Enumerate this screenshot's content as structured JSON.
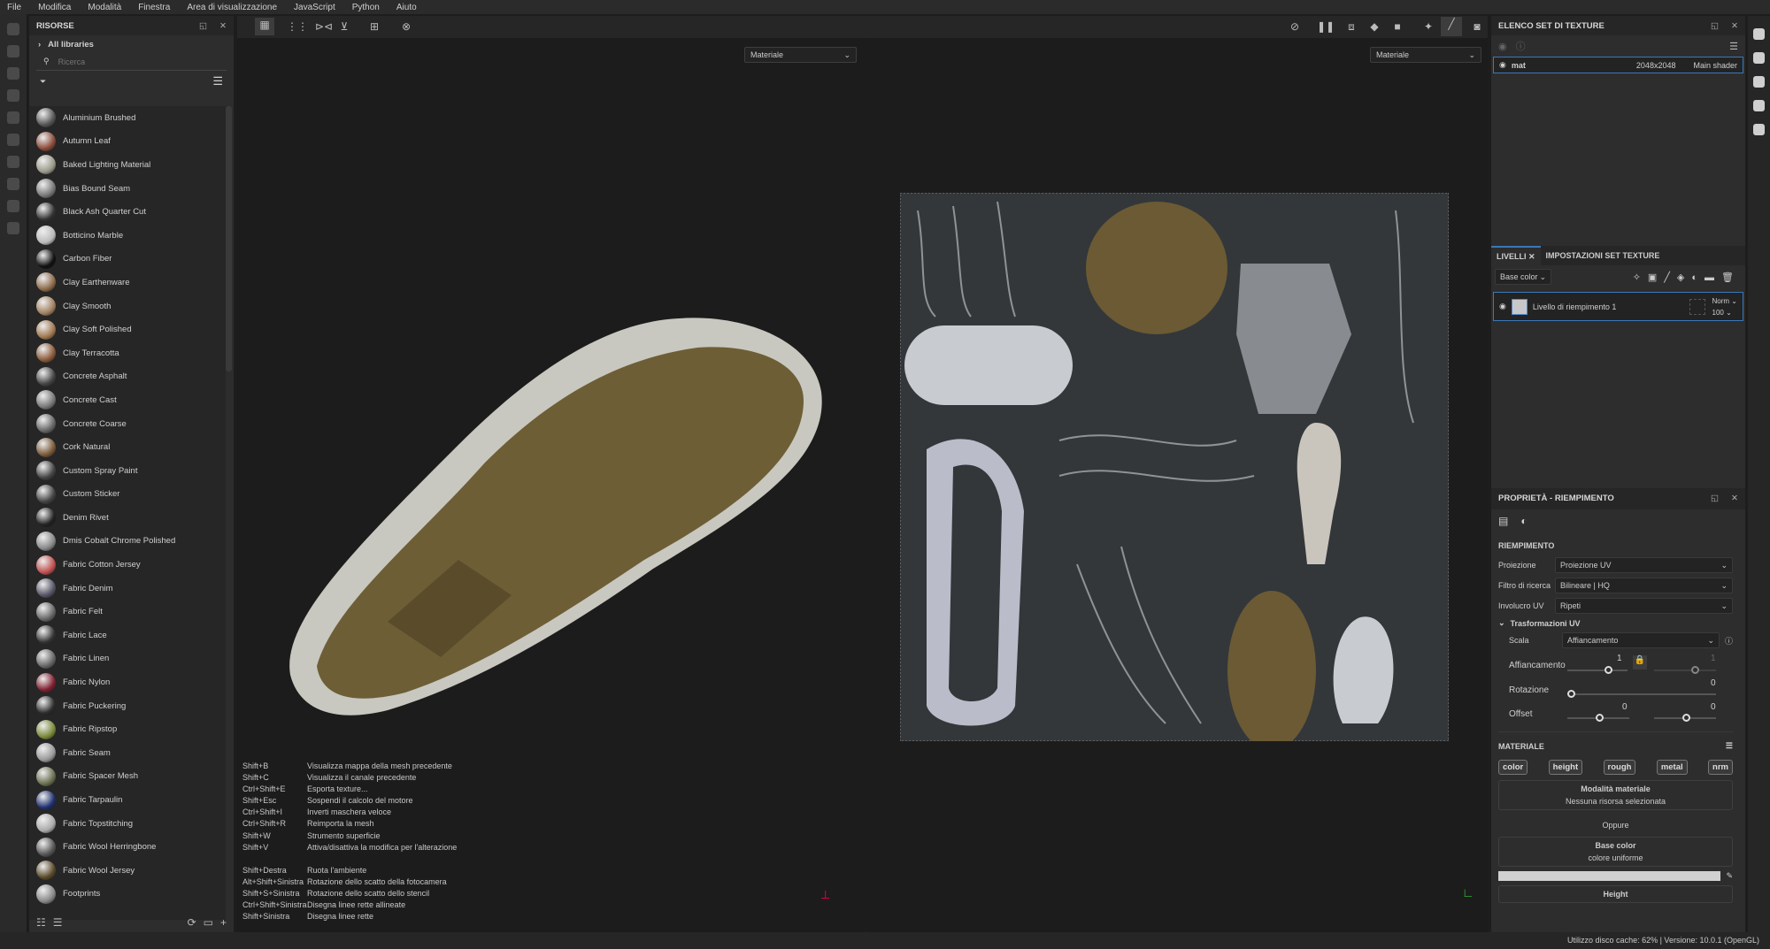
{
  "menu": [
    "File",
    "Modifica",
    "Modalità",
    "Finestra",
    "Area di visualizzazione",
    "JavaScript",
    "Python",
    "Aiuto"
  ],
  "assets": {
    "title": "RISORSE",
    "library": "All libraries",
    "search_placeholder": "Ricerca",
    "items": [
      {
        "label": "Aluminium Brushed",
        "color": "#555"
      },
      {
        "label": "Autumn Leaf",
        "color": "#8a4a3a"
      },
      {
        "label": "Baked Lighting Material",
        "color": "#9a9a8a"
      },
      {
        "label": "Bias Bound Seam",
        "color": "#777"
      },
      {
        "label": "Black Ash Quarter Cut",
        "color": "#333"
      },
      {
        "label": "Botticino Marble",
        "color": "#bbb"
      },
      {
        "label": "Carbon Fiber",
        "color": "#111"
      },
      {
        "label": "Clay Earthenware",
        "color": "#8c6a4a"
      },
      {
        "label": "Clay Smooth",
        "color": "#a08060"
      },
      {
        "label": "Clay Soft Polished",
        "color": "#a07850"
      },
      {
        "label": "Clay Terracotta",
        "color": "#8a5a3a"
      },
      {
        "label": "Concrete Asphalt",
        "color": "#444"
      },
      {
        "label": "Concrete Cast",
        "color": "#777"
      },
      {
        "label": "Concrete Coarse",
        "color": "#666"
      },
      {
        "label": "Cork Natural",
        "color": "#7a5a3a"
      },
      {
        "label": "Custom Spray Paint",
        "color": "#444"
      },
      {
        "label": "Custom Sticker",
        "color": "#444"
      },
      {
        "label": "Denim Rivet",
        "color": "#222"
      },
      {
        "label": "Dmis Cobalt Chrome Polished",
        "color": "#888"
      },
      {
        "label": "Fabric Cotton Jersey",
        "color": "#c05050"
      },
      {
        "label": "Fabric Denim",
        "color": "#556"
      },
      {
        "label": "Fabric Felt",
        "color": "#666"
      },
      {
        "label": "Fabric Lace",
        "color": "#333"
      },
      {
        "label": "Fabric Linen",
        "color": "#666"
      },
      {
        "label": "Fabric Nylon",
        "color": "#802030"
      },
      {
        "label": "Fabric Puckering",
        "color": "#2d2d2d"
      },
      {
        "label": "Fabric Ripstop",
        "color": "#7a8a3a"
      },
      {
        "label": "Fabric Seam",
        "color": "#999"
      },
      {
        "label": "Fabric Spacer Mesh",
        "color": "#6a7050"
      },
      {
        "label": "Fabric Tarpaulin",
        "color": "#203070"
      },
      {
        "label": "Fabric Topstitching",
        "color": "#aaa"
      },
      {
        "label": "Fabric Wool Herringbone",
        "color": "#555"
      },
      {
        "label": "Fabric Wool Jersey",
        "color": "#5a4a2a"
      },
      {
        "label": "Footprints",
        "color": "#888"
      }
    ]
  },
  "viewport": {
    "material_dropdown_3d": "Materiale",
    "material_dropdown_uv": "Materiale"
  },
  "shortcuts": [
    [
      "Shift+B",
      "Visualizza mappa della mesh precedente"
    ],
    [
      "Shift+C",
      "Visualizza il canale precedente"
    ],
    [
      "Ctrl+Shift+E",
      "Esporta texture..."
    ],
    [
      "Shift+Esc",
      "Sospendi il calcolo del motore"
    ],
    [
      "Ctrl+Shift+I",
      "Inverti maschera veloce"
    ],
    [
      "Ctrl+Shift+R",
      "Reimporta la mesh"
    ],
    [
      "Shift+W",
      "Strumento superficie"
    ],
    [
      "Shift+V",
      "Attiva/disattiva la modifica per l'alterazione"
    ],
    [
      "",
      ""
    ],
    [
      "Shift+Destra",
      "Ruota l'ambiente"
    ],
    [
      "Alt+Shift+Sinistra",
      "Rotazione dello scatto della fotocamera"
    ],
    [
      "Shift+S+Sinistra",
      "Rotazione dello scatto dello stencil"
    ],
    [
      "Ctrl+Shift+Sinistra",
      "Disegna linee rette allineate"
    ],
    [
      "Shift+Sinistra",
      "Disegna linee rette"
    ]
  ],
  "texture_sets": {
    "title": "ELENCO SET DI TEXTURE",
    "row": {
      "name": "mat",
      "size": "2048x2048",
      "shader": "Main shader"
    }
  },
  "layers": {
    "tab_layers": "LIVELLI",
    "tab_settings": "IMPOSTAZIONI SET TEXTURE",
    "channel": "Base color",
    "layer": {
      "name": "Livello di riempimento 1",
      "blend": "Norm",
      "opacity": "100"
    }
  },
  "properties": {
    "title": "PROPRIETÀ - RIEMPIMENTO",
    "section": "RIEMPIMENTO",
    "projection_label": "Proiezione",
    "projection": "Proiezione UV",
    "filter_label": "Filtro di ricerca",
    "filter": "Bilineare | HQ",
    "wrap_label": "Involucro UV",
    "wrap": "Ripeti",
    "uv_transform": "Trasformazioni UV",
    "scale_label": "Scala",
    "scale": "Affiancamento",
    "tiling_label": "Affiancamento",
    "tiling": "1",
    "tiling2": "1",
    "rotation_label": "Rotazione",
    "rotation": "0",
    "offset_label": "Offset",
    "offset_x": "0",
    "offset_y": "0",
    "material_section": "MATERIALE",
    "chips": [
      "color",
      "height",
      "rough",
      "metal",
      "nrm"
    ],
    "material_mode": "Modalità materiale",
    "no_resource": "Nessuna risorsa selezionata",
    "or": "Oppure",
    "base_color": "Base color",
    "uniform": "colore uniforme",
    "base_color_value": "#d0d0d0",
    "height": "Height"
  },
  "status": "Utilizzo disco cache:   62% | Versione: 10.0.1 (OpenGL)"
}
